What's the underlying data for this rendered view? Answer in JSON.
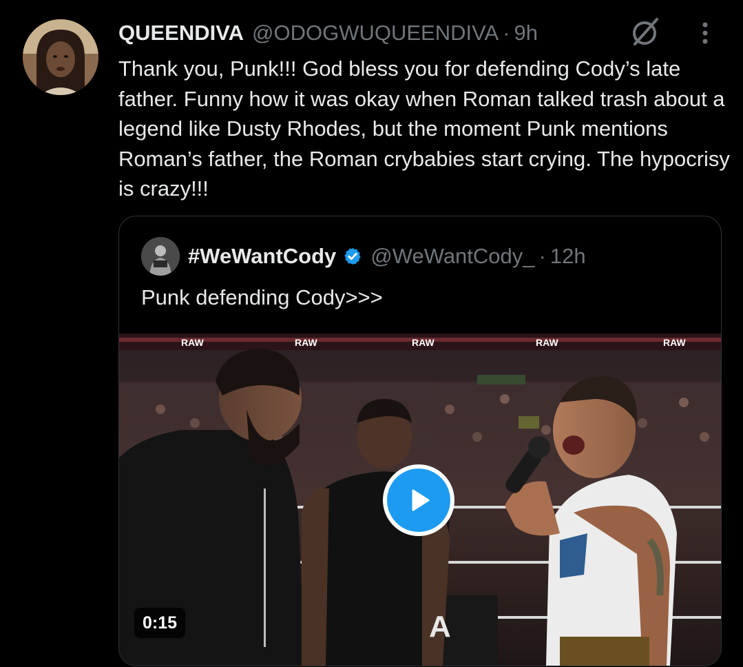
{
  "tweet": {
    "display_name": "QUEENDIVA",
    "handle": "@ODOGWUQUEENDIVA",
    "separator": "·",
    "time": "9h",
    "text": "Thank you, Punk!!! God bless you for defending Cody’s late father. Funny how it was okay when Roman talked trash about a legend like Dusty Rhodes, but the moment Punk mentions Roman’s father, the Roman crybabies start crying. The hypocrisy is crazy!!!",
    "grok_icon": "grok-icon",
    "more_icon": "more-dots-icon"
  },
  "quoted": {
    "display_name": "#WeWantCody",
    "handle": "@WeWantCody_",
    "separator": "·",
    "time": "12h",
    "text": "Punk defending Cody>>>",
    "verified_icon": "verified-badge-icon",
    "video": {
      "duration": "0:15",
      "banner_text": "RAW",
      "play_icon": "play-icon"
    }
  },
  "colors": {
    "background": "#000000",
    "primary_text": "#e7e9ea",
    "secondary_text": "#71767b",
    "border": "#2f3336",
    "accent": "#1d9bf0"
  }
}
